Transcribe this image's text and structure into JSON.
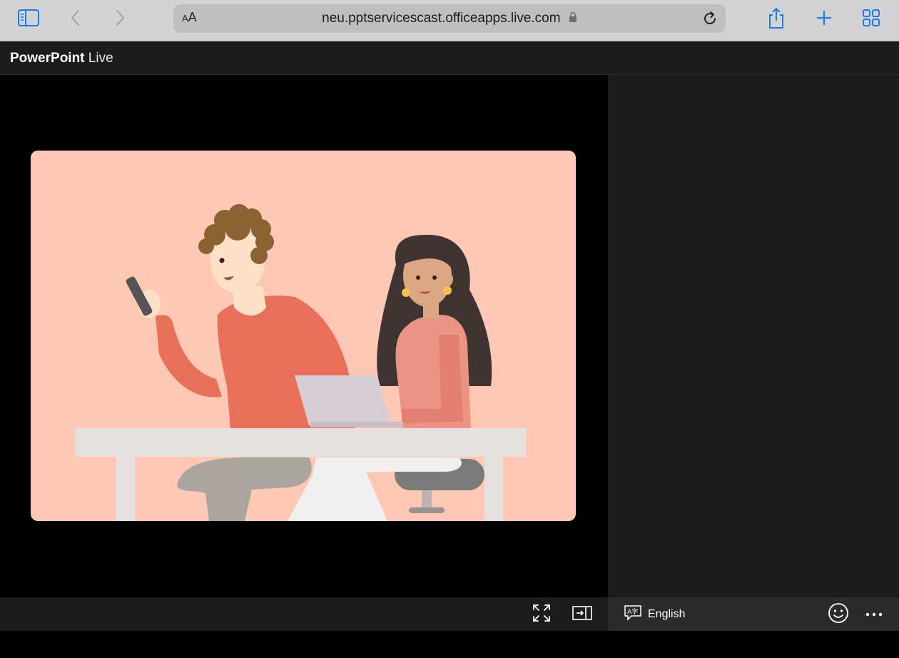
{
  "browser": {
    "url": "neu.pptservicescast.officeapps.live.com",
    "text_size_small": "A",
    "text_size_large": "A",
    "icons": [
      "sidebar-icon",
      "back-icon",
      "forward-icon",
      "lock-icon",
      "reload-icon",
      "share-icon",
      "plus-icon",
      "tabs-icon"
    ],
    "accent_color": "#1a7cf0"
  },
  "app": {
    "title_bold": "PowerPoint",
    "title_light": " Live"
  },
  "slide": {
    "background_color": "#fec8b4",
    "illustration": "two-people-at-desk"
  },
  "bottom_bar": {
    "language": "English",
    "icons": [
      "fullscreen-icon",
      "panel-toggle-icon",
      "translate-icon",
      "emoji-reaction-icon",
      "more-icon"
    ]
  }
}
